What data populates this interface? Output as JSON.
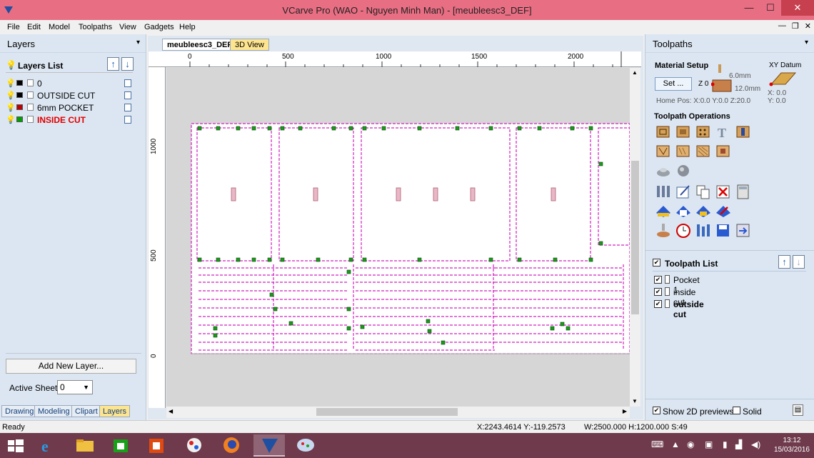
{
  "window": {
    "title": "VCarve Pro (WAO - Nguyen Minh Man) - [meubleesc3_DEF]",
    "min": "—",
    "max": "☐",
    "close": "✕"
  },
  "menu": [
    "File",
    "Edit",
    "Model",
    "Toolpaths",
    "View",
    "Gadgets",
    "Help"
  ],
  "mdi": {
    "min": "—",
    "restore": "❐",
    "close": "✕"
  },
  "layers_panel": {
    "title": "Layers",
    "pin": "📌",
    "list_title": "Layers List",
    "layers": [
      {
        "name": "0",
        "color": "#000000",
        "name_color": "#000000"
      },
      {
        "name": "OUTSIDE CUT",
        "color": "#000000",
        "name_color": "#000000"
      },
      {
        "name": "6mm POCKET",
        "color": "#c00000",
        "name_color": "#000000"
      },
      {
        "name": "INSIDE CUT",
        "color": "#00a000",
        "name_color": "#e00000"
      }
    ],
    "add_button": "Add New Layer...",
    "active_sheet_label": "Active Sheet:",
    "active_sheet_value": "0"
  },
  "bottom_tabs": [
    "Drawing",
    "Modeling",
    "Clipart",
    "Layers"
  ],
  "document_tabs": [
    "meubleesc3_DEF",
    "3D View"
  ],
  "ruler": {
    "h_labels": [
      "0",
      "500",
      "1000",
      "1500",
      "2000"
    ],
    "v_labels": [
      "1000",
      "500",
      "0"
    ]
  },
  "toolpaths_panel": {
    "title": "Toolpaths",
    "material_setup": "Material Setup",
    "set_button": "Set ...",
    "dim_top": "6.0mm",
    "dim_bottom": "12.0mm",
    "z_label": "Z 0",
    "xy_datum": "XY Datum",
    "x_datum": "X: 0.0",
    "y_datum": "Y: 0.0",
    "home_pos": "Home Pos:  X:0.0 Y:0.0 Z:20.0",
    "operations_title": "Toolpath Operations",
    "list_title": "Toolpath List",
    "toolpaths": [
      {
        "name": "Pocket 1",
        "bold": false
      },
      {
        "name": "inside cut",
        "bold": false
      },
      {
        "name": "outside cut",
        "bold": true
      }
    ],
    "show_previews": "Show 2D previews",
    "solid": "Solid"
  },
  "status": {
    "ready": "Ready",
    "coords": "X:2243.4614 Y:-119.2573",
    "size": "W:2500.000   H:1200.000   S:49"
  },
  "taskbar": {
    "time": "13:12",
    "date": "15/03/2016"
  },
  "colors": {
    "title_bar": "#e86e83",
    "panel": "#dce6f2",
    "toolpath": "#d020c0",
    "node": "#1a9a1a",
    "taskbar": "#6e3a4c"
  }
}
